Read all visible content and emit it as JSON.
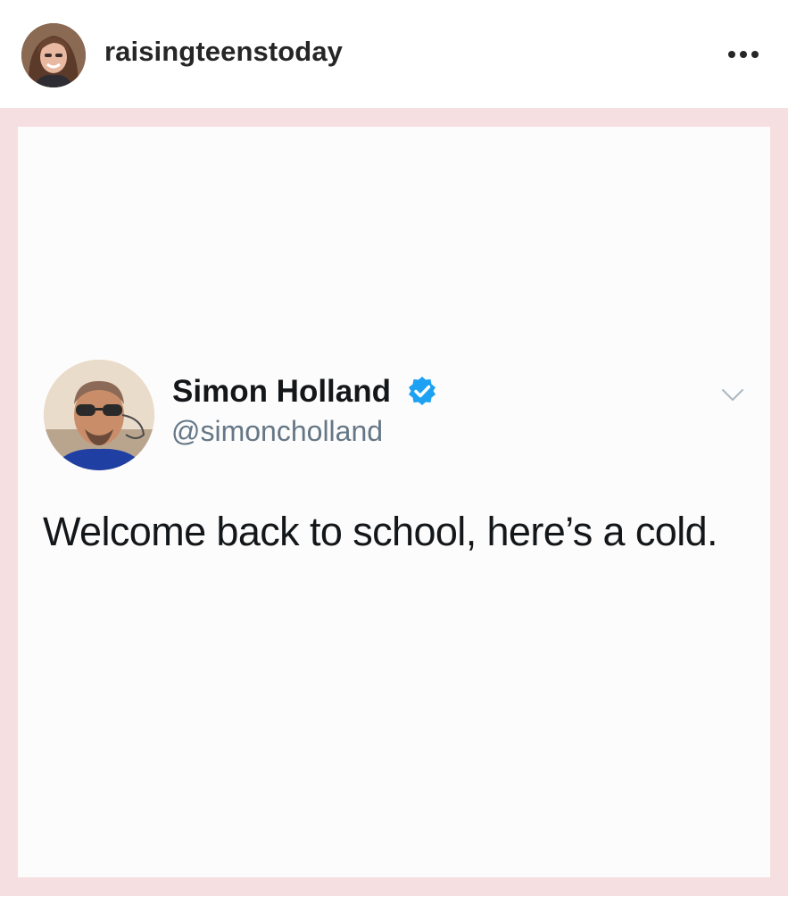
{
  "post": {
    "author": {
      "username": "raisingteenstoday",
      "avatar_icon": "profile-photo"
    },
    "more_icon": "more-horizontal-icon"
  },
  "tweet": {
    "display_name": "Simon Holland",
    "verified": true,
    "verified_icon": "verified-badge-icon",
    "handle": "@simoncholland",
    "caret_icon": "chevron-down-icon",
    "text": "Welcome back to school, here’s a cold.",
    "avatar_icon": "profile-photo"
  },
  "colors": {
    "frame_background": "#f6dfe1",
    "card_background": "#fdfcfc",
    "verified_blue": "#1da1f2",
    "handle_gray": "#657786",
    "text_dark": "#14171a"
  }
}
